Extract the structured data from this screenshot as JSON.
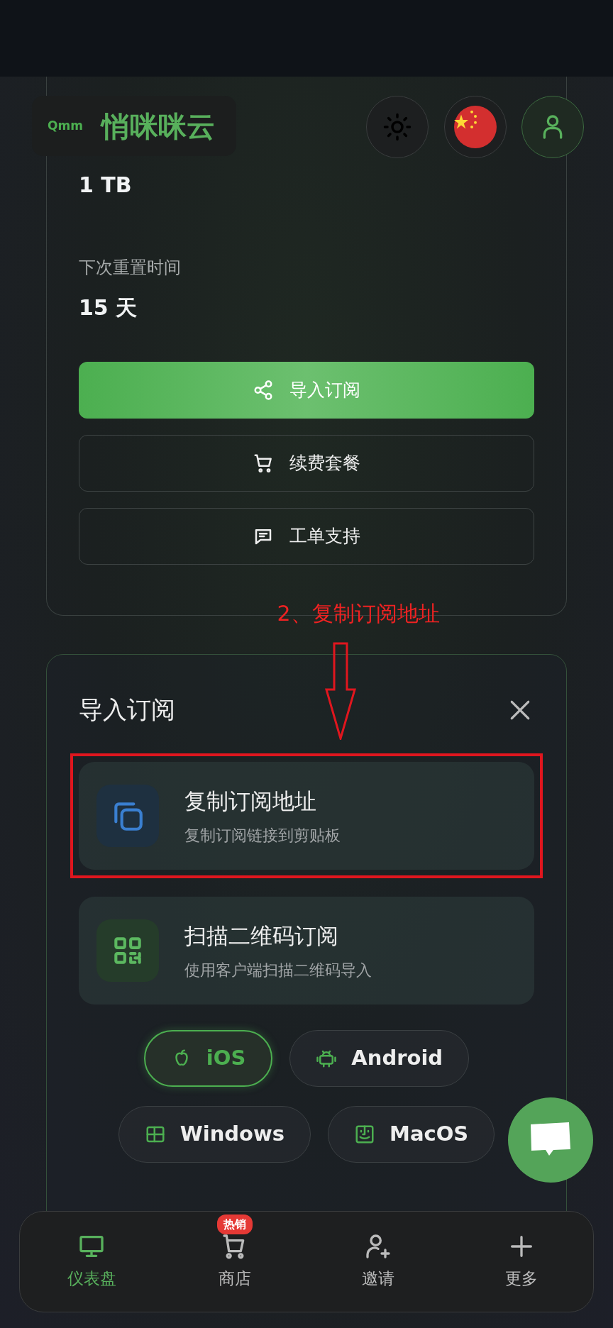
{
  "header": {
    "logo_mark": "Qmm",
    "brand": "悄咪咪云"
  },
  "stats": [
    {
      "value": "1 TB"
    },
    {
      "label": "下次重置时间",
      "value": "15 天"
    }
  ],
  "actions": [
    {
      "label": "导入订阅",
      "kind": "primary"
    },
    {
      "label": "续费套餐",
      "kind": "outline"
    },
    {
      "label": "工单支持",
      "kind": "outline"
    }
  ],
  "annotation": {
    "text": "2、复制订阅地址"
  },
  "import_panel": {
    "title": "导入订阅",
    "options": [
      {
        "title": "复制订阅地址",
        "subtitle": "复制订阅链接到剪贴板",
        "highlighted": true
      },
      {
        "title": "扫描二维码订阅",
        "subtitle": "使用客户端扫描二维码导入",
        "highlighted": false
      }
    ],
    "platforms": [
      {
        "label": "iOS",
        "selected": true
      },
      {
        "label": "Android",
        "selected": false
      },
      {
        "label": "Windows",
        "selected": false
      },
      {
        "label": "MacOS",
        "selected": false
      }
    ]
  },
  "bottom_nav": [
    {
      "label": "仪表盘",
      "selected": true
    },
    {
      "label": "商店",
      "selected": false,
      "badge": "热销"
    },
    {
      "label": "邀请",
      "selected": false
    },
    {
      "label": "更多",
      "selected": false
    }
  ]
}
